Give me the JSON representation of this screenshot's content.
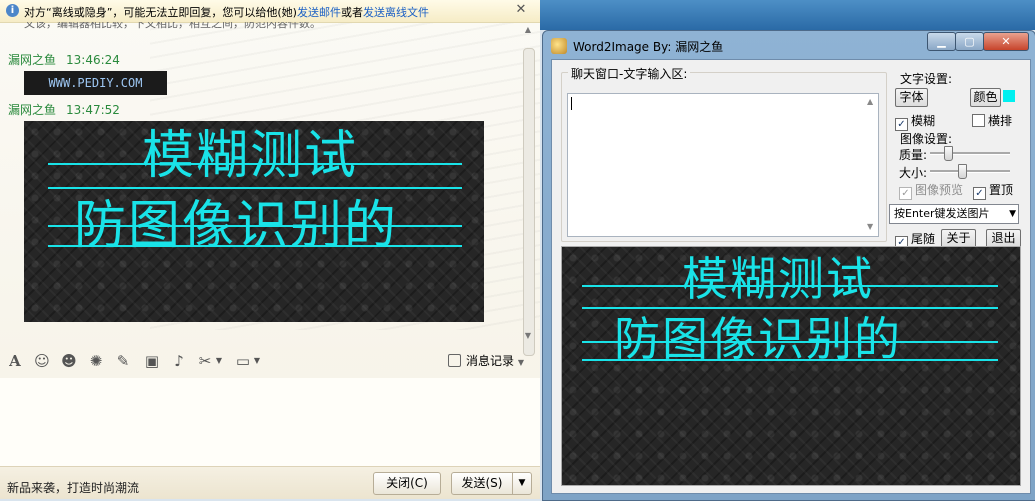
{
  "chat": {
    "notification": {
      "prefix": "对方“离线或隐身”，可能无法立即回复，您可以给他(她)",
      "link1": "发送邮件",
      "middle": "或者",
      "link2": "发送离线文件"
    },
    "cut_line": "文该，编辑器相比较，下文相比，相互之间，防范内容件数。",
    "messages": [
      {
        "sender": "漏网之鱼",
        "time": "13:46:24",
        "content": "WWW.PEDIY.COM"
      },
      {
        "sender": "漏网之鱼",
        "time": "13:47:52",
        "image_line1": "模糊测试",
        "image_line2": "防图像识别的"
      }
    ],
    "toolbar": {
      "history_label": "消息记录"
    },
    "status": {
      "slogan": "新品来袭，打造时尚潮流",
      "close_label": "关闭(C)",
      "send_label": "发送(S)"
    }
  },
  "app": {
    "title": "Word2Image By: 漏网之鱼",
    "input_group_label": "聊天窗口-文字输入区:",
    "input_value": "",
    "text_settings_label": "文字设置:",
    "font_button": "字体",
    "color_button": "颜色",
    "text_color": "#00f0f0",
    "blur_label": "模糊",
    "blur_checked": true,
    "vertical_label": "横排",
    "vertical_checked": false,
    "image_settings_label": "图像设置:",
    "quality_label": "质量:",
    "quality_level": 0.2,
    "size_label": "大小:",
    "size_level": 0.4,
    "preview_label": "图像预览",
    "preview_checked": true,
    "topmost_label": "置顶",
    "topmost_checked": true,
    "send_mode": "按Enter键发送图片",
    "follow_label": "尾随",
    "follow_checked": true,
    "about_button": "关于",
    "exit_button": "退出",
    "preview_line1": "模糊测试",
    "preview_line2": "防图像识别的"
  },
  "colors": {
    "accent_text": "#19e3e8",
    "sender_green": "#2a8a3d",
    "link_blue": "#1a5fc4"
  }
}
